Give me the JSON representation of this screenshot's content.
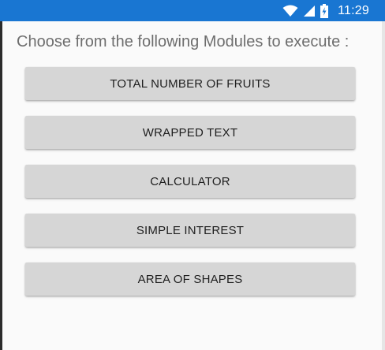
{
  "status_bar": {
    "time": "11:29",
    "icons": [
      "wifi-icon",
      "signal-icon",
      "battery-charging-icon"
    ],
    "background_color": "#1976d2"
  },
  "heading": "Choose from the following Modules to execute :",
  "modules": [
    {
      "label": "TOTAL NUMBER OF FRUITS"
    },
    {
      "label": "WRAPPED TEXT"
    },
    {
      "label": "CALCULATOR"
    },
    {
      "label": "SIMPLE INTEREST"
    },
    {
      "label": "AREA OF SHAPES"
    }
  ]
}
